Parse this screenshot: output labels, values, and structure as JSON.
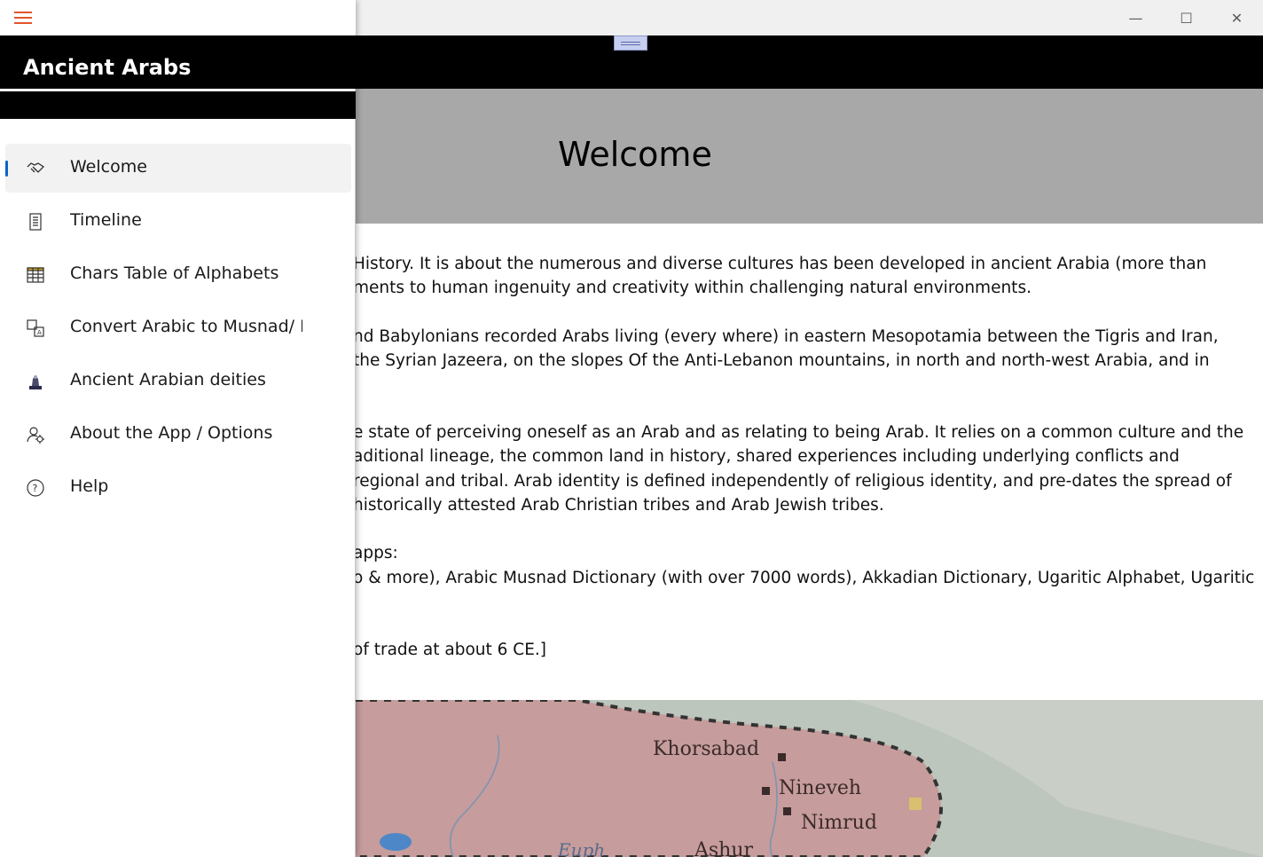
{
  "window": {
    "minimize_glyph": "—",
    "maximize_glyph": "☐",
    "close_glyph": "✕"
  },
  "sidebar": {
    "app_title": "Ancient Arabs",
    "items": [
      {
        "label": "Welcome",
        "icon": "handshake-icon",
        "active": true
      },
      {
        "label": "Timeline",
        "icon": "document-list-icon",
        "active": false
      },
      {
        "label": "Chars Table of Alphabets",
        "icon": "table-icon",
        "active": false
      },
      {
        "label": "Convert Arabic to Musnad/ F",
        "icon": "translate-icon",
        "active": false
      },
      {
        "label": "Ancient Arabian deities",
        "icon": "statue-icon",
        "active": false
      },
      {
        "label": "About the App / Options",
        "icon": "person-gear-icon",
        "active": false
      },
      {
        "label": "Help",
        "icon": "help-circle-icon",
        "active": false
      }
    ]
  },
  "banner": {
    "title": "Welcome"
  },
  "content": {
    "paragraphs": [
      [
        "History. It is about the numerous and diverse cultures has been developed in ancient Arabia (more than",
        "ments to human ingenuity and creativity within challenging natural environments."
      ],
      [
        "nd Babylonians recorded Arabs living (every where) in eastern Mesopotamia between the Tigris and Iran,",
        "the Syrian Jazeera, on the slopes Of the Anti-Lebanon mountains, in north and north-west Arabia, and in",
        ""
      ],
      [
        "e state of perceiving oneself as an Arab and as relating to being Arab. It relies on a common culture and the",
        "aditional lineage, the common land in history, shared experiences including underlying conflicts and",
        " regional and tribal. Arab identity is defined independently of religious identity, and pre-dates the spread of",
        " historically attested Arab Christian tribes and Arab Jewish tribes."
      ],
      [
        "apps:",
        "o & more), Arabic Musnad Dictionary (with over 7000 words), Akkadian Dictionary, Ugaritic Alphabet, Ugaritic",
        ""
      ],
      [
        "of trade at about 6 CE.]"
      ]
    ]
  },
  "map": {
    "labels": [
      "Khorsabad",
      "Nineveh",
      "Nimrud",
      "Ashur",
      "Euph"
    ]
  }
}
